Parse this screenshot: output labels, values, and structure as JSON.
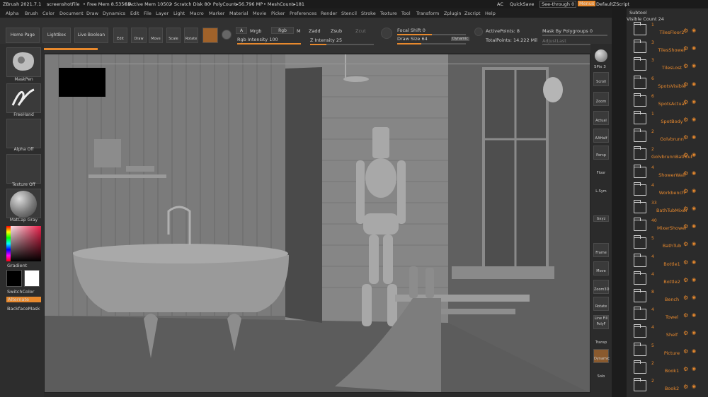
{
  "titlebar": {
    "app": "ZBrush 2021.7.1",
    "file": "screenshotFile",
    "free_mem": "• Free Mem 8.535GB",
    "active_mem": "• Active Mem 10502",
    "scratch": "• Scratch Disk 80",
    "polycount": "• PolyCount▸56.796 MP",
    "meshcount": "• MeshCount▸181",
    "ac": "AC",
    "quicksave": "QuickSave",
    "see_through": "See-through  0",
    "menus": "Menus",
    "default_script": "DefaultZScript"
  },
  "menubar": [
    "Alpha",
    "Brush",
    "Color",
    "Document",
    "Draw",
    "Dynamics",
    "Edit",
    "File",
    "Layer",
    "Light",
    "Macro",
    "Marker",
    "Material",
    "Movie",
    "Picker",
    "Preferences",
    "Render",
    "Stencil",
    "Stroke",
    "Texture",
    "Tool",
    "Transform",
    "Zplugin",
    "Zscript",
    "Help"
  ],
  "toolbar": {
    "home_page": "Home Page",
    "lightbox": "LightBox",
    "live_boolean": "Live Boolean",
    "edit": "Edit",
    "draw": "Draw",
    "move": "Move",
    "scale": "Scale",
    "rotate": "Rotate",
    "a_btn": "A",
    "mrgb": "Mrgb",
    "rgb": "Rgb",
    "m_btn": "M",
    "zadd": "Zadd",
    "zsub": "Zsub",
    "zcut": "Zcut",
    "rgb_intensity": "Rgb Intensity 100",
    "z_intensity": "Z Intensity 25",
    "focal_shift": "Focal Shift 0",
    "draw_size": "Draw Size 64",
    "dynamic": "Dynamic",
    "active_points": "ActivePoints: 8",
    "total_points": "TotalPoints: 14.222 Mil",
    "mask_by_polygroups": "Mask By Polygroups 0",
    "adjust_last": "AdjustLast"
  },
  "left_shelf": {
    "brush": "MaskPen",
    "stroke": "FreeHand",
    "alpha": "Alpha Off",
    "texture": "Texture Off",
    "material": "MatCap Gray",
    "gradient": "Gradient",
    "switch_color": "SwitchColor",
    "alternate": "Alternate",
    "backface_mask": "BackfaceMask"
  },
  "right_shelf": [
    "SPix 3",
    "Scroll",
    "Zoom",
    "Actual",
    "AAHalf",
    "Persp",
    "Floor",
    "L.Sym",
    "Gxyz",
    "Frame",
    "Move",
    "Zoom3D",
    "Rotate",
    "Line Fill PolyF",
    "Transp",
    "Dynamic",
    "Solo"
  ],
  "subtool": {
    "title": "Subtool",
    "visible_count": "Visible Count 24",
    "items": [
      {
        "count": "1",
        "name": "TilesFloor2"
      },
      {
        "count": "3",
        "name": "TilesShower"
      },
      {
        "count": "3",
        "name": "TilesLost"
      },
      {
        "count": "6",
        "name": "SpotsVisible"
      },
      {
        "count": "6",
        "name": "SpotsActual"
      },
      {
        "count": "1",
        "name": "SpotBody"
      },
      {
        "count": "2",
        "name": "Golvbrunn"
      },
      {
        "count": "2",
        "name": "GolvbrunnBathtub"
      },
      {
        "count": "4",
        "name": "ShowerWall"
      },
      {
        "count": "4",
        "name": "Workbench"
      },
      {
        "count": "33",
        "name": "BathTubMixer"
      },
      {
        "count": "40",
        "name": "MixerShower"
      },
      {
        "count": "5",
        "name": "BathTub"
      },
      {
        "count": "4",
        "name": "Bottle1"
      },
      {
        "count": "4",
        "name": "Bottle2"
      },
      {
        "count": "8",
        "name": "Bench"
      },
      {
        "count": "4",
        "name": "Towel"
      },
      {
        "count": "4",
        "name": "Shelf"
      },
      {
        "count": "5",
        "name": "Picture"
      },
      {
        "count": "2",
        "name": "Book1"
      },
      {
        "count": "2",
        "name": "Book2"
      }
    ]
  },
  "colors": {
    "accent": "#e8892d",
    "panel": "#2b2b2b",
    "viewport": "#6e6e6e"
  },
  "icons": {
    "settings": "gear-icon",
    "visibility": "eye-icon",
    "folder": "folder-icon"
  }
}
